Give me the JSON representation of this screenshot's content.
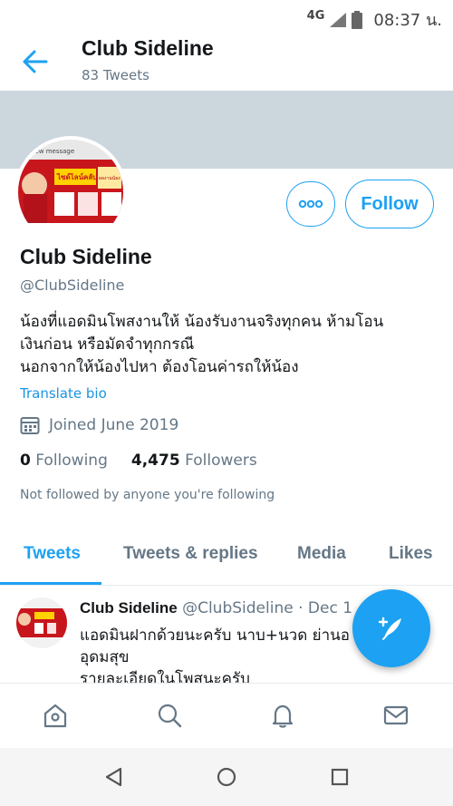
{
  "status_bar": {
    "network": "4G",
    "time": "08:37 น."
  },
  "header": {
    "title": "Club Sideline",
    "subtitle": "83 Tweets"
  },
  "colors": {
    "accent": "#1da1f2",
    "banner": "#ccd6dd",
    "muted": "#657786"
  },
  "profile": {
    "name": "Club Sideline",
    "handle": "@ClubSideline",
    "bio_lines": [
      "น้องที่แอดมินโพสงานให้ น้องรับงานจริงทุกคน ห้ามโอน",
      "เงินก่อน หรือมัดจำทุกกรณี",
      "นอกจากให้น้องไปหา ต้องโอนค่ารถให้น้อง"
    ],
    "translate_label": "Translate bio",
    "joined": "Joined June 2019",
    "following_count": "0",
    "following_label": "Following",
    "followers_count": "4,475",
    "followers_label": "Followers",
    "not_followed": "Not followed by anyone you're following",
    "follow_button": "Follow",
    "more_icon": "more-options-icon"
  },
  "avatar_image": {
    "banner_text": "new message",
    "promo_text": "ไซด์ไลน์คลับ",
    "promo_text2": "ผลงานน้อง"
  },
  "tabs": [
    {
      "label": "Tweets",
      "active": true
    },
    {
      "label": "Tweets & replies",
      "active": false
    },
    {
      "label": "Media",
      "active": false
    },
    {
      "label": "Likes",
      "active": false
    }
  ],
  "tweet": {
    "name": "Club Sideline",
    "handle": "@ClubSideline",
    "sep": "·",
    "date": "Dec 1",
    "lines": [
      "แอดมินฝากด้วยนะครับ นาบ+นวด ย่านอ",
      "อุดมสุข",
      "รายละเอียดในโพสนะครับ"
    ]
  },
  "bottom_nav": [
    "home-icon",
    "search-icon",
    "notifications-icon",
    "messages-icon"
  ],
  "system_nav": [
    "back-triangle-icon",
    "home-circle-icon",
    "recents-square-icon"
  ]
}
